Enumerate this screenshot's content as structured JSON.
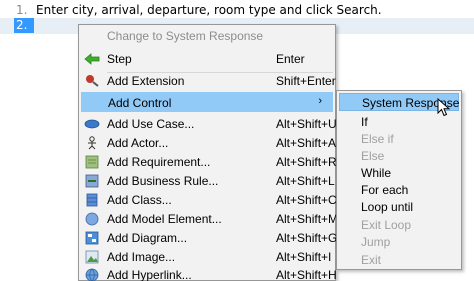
{
  "editor": {
    "lines": [
      {
        "number": "1.",
        "text": "Enter city, arrival, departure, room type and click Search."
      },
      {
        "number": "2.",
        "text": ""
      }
    ]
  },
  "context_menu": {
    "items": [
      {
        "label": "Change to System Response",
        "shortcut": "",
        "icon": "",
        "disabled": true
      },
      {
        "label": "Step",
        "shortcut": "Enter",
        "icon": "green-arrow-icon"
      },
      {
        "label": "Add Extension",
        "shortcut": "Shift+Enter",
        "icon": "extension-icon"
      },
      {
        "label": "Add Control",
        "shortcut": "",
        "icon": "",
        "submenu_arrow": "›"
      },
      {
        "label": "Add Use Case...",
        "shortcut": "Alt+Shift+U",
        "icon": "use-case-icon"
      },
      {
        "label": "Add Actor...",
        "shortcut": "Alt+Shift+A",
        "icon": "actor-icon"
      },
      {
        "label": "Add Requirement...",
        "shortcut": "Alt+Shift+R",
        "icon": "requirement-icon"
      },
      {
        "label": "Add Business Rule...",
        "shortcut": "Alt+Shift+L",
        "icon": "business-rule-icon"
      },
      {
        "label": "Add Class...",
        "shortcut": "Alt+Shift+C",
        "icon": "class-icon"
      },
      {
        "label": "Add Model Element...",
        "shortcut": "Alt+Shift+M",
        "icon": "model-element-icon"
      },
      {
        "label": "Add Diagram...",
        "shortcut": "Alt+Shift+G",
        "icon": "diagram-icon"
      },
      {
        "label": "Add Image...",
        "shortcut": "Alt+Shift+I",
        "icon": "image-icon"
      },
      {
        "label": "Add Hyperlink...",
        "shortcut": "Alt+Shift+H",
        "icon": "hyperlink-icon"
      }
    ]
  },
  "submenu": {
    "items": [
      {
        "label": "System Response",
        "disabled": false,
        "highlighted": true
      },
      {
        "label": "If",
        "disabled": false
      },
      {
        "label": "Else if",
        "disabled": true
      },
      {
        "label": "Else",
        "disabled": true
      },
      {
        "label": "While",
        "disabled": false
      },
      {
        "label": "For each",
        "disabled": false
      },
      {
        "label": "Loop until",
        "disabled": false
      },
      {
        "label": "Exit Loop",
        "disabled": true
      },
      {
        "label": "Jump",
        "disabled": true
      },
      {
        "label": "Exit",
        "disabled": true
      }
    ]
  },
  "colors": {
    "highlight": "#91c9f7",
    "selection": "#3399ff"
  }
}
